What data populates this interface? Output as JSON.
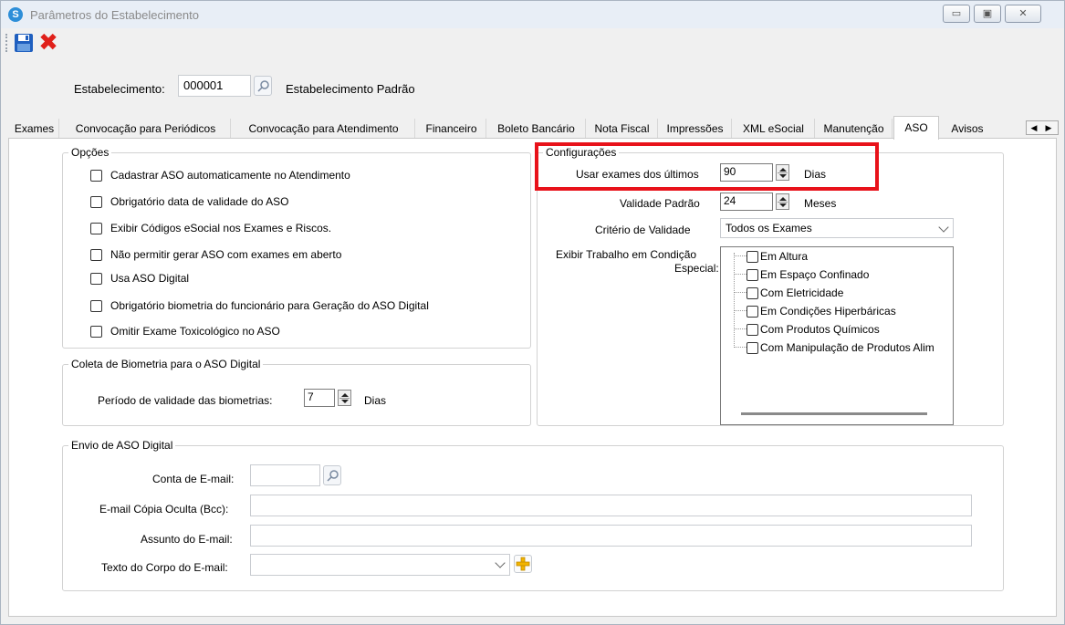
{
  "window": {
    "title": "Parâmetros do Estabelecimento",
    "controls": [
      "▭",
      "▣",
      "✕"
    ]
  },
  "header": {
    "estabelecimento_label": "Estabelecimento:",
    "estabelecimento_code": "000001",
    "estabelecimento_name": "Estabelecimento Padrão"
  },
  "tabs": [
    {
      "label": "Exames"
    },
    {
      "label": "Convocação para Periódicos"
    },
    {
      "label": "Convocação para Atendimento"
    },
    {
      "label": "Financeiro"
    },
    {
      "label": "Boleto Bancário"
    },
    {
      "label": "Nota Fiscal"
    },
    {
      "label": "Impressões"
    },
    {
      "label": "XML eSocial"
    },
    {
      "label": "Manutenção"
    },
    {
      "label": "ASO",
      "active": true
    },
    {
      "label": "Avisos"
    }
  ],
  "opcoes": {
    "title": "Opções",
    "items": [
      {
        "label": "Cadastrar ASO automaticamente no Atendimento",
        "checked": false
      },
      {
        "label": "Obrigatório data de validade do ASO",
        "checked": false
      },
      {
        "label": "Exibir Códigos eSocial nos Exames e Riscos.",
        "checked": false
      },
      {
        "label": "Não permitir gerar ASO com exames em aberto",
        "checked": false
      },
      {
        "label": "Usa ASO Digital",
        "checked": false
      },
      {
        "label": "Obrigatório biometria do funcionário para Geração do ASO Digital",
        "checked": false
      },
      {
        "label": "Omitir Exame Toxicológico no ASO",
        "checked": false
      }
    ]
  },
  "biometria": {
    "title": "Coleta de Biometria para o ASO Digital",
    "periodo_label": "Período de validade das biometrias:",
    "periodo_value": "7",
    "periodo_unit": "Dias"
  },
  "configuracoes": {
    "title": "Configurações",
    "usar_exames_label": "Usar exames dos últimos",
    "usar_exames_value": "90",
    "usar_exames_unit": "Dias",
    "validade_label": "Validade Padrão",
    "validade_value": "24",
    "validade_unit": "Meses",
    "criterio_label": "Critério de Validade",
    "criterio_value": "Todos os Exames",
    "trabalho_label_line1": "Exibir Trabalho em Condição",
    "trabalho_label_line2": "Especial:",
    "trabalho_items": [
      "Em Altura",
      "Em Espaço Confinado",
      "Com Eletricidade",
      "Em Condições Hiperbáricas",
      "Com Produtos Químicos",
      "Com Manipulação de Produtos Alim"
    ]
  },
  "envio": {
    "title": "Envio de ASO Digital",
    "conta_label": "Conta de E-mail:",
    "conta_value": "",
    "bcc_label": "E-mail Cópia Oculta (Bcc):",
    "bcc_value": "",
    "assunto_label": "Assunto do E-mail:",
    "assunto_value": "",
    "corpo_label": "Texto do Corpo do E-mail:",
    "corpo_value": ""
  },
  "colors": {
    "highlight": "#e8121a",
    "close_icon": "#e0201a",
    "save_icon": "#1f5fbf"
  }
}
